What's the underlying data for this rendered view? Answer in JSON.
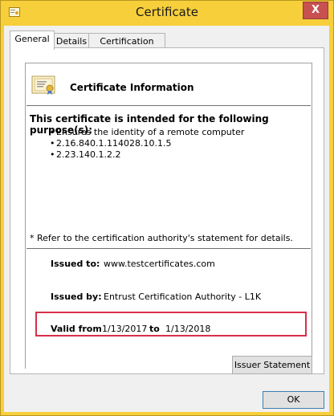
{
  "window": {
    "title": "Certificate",
    "close_label": "X"
  },
  "tabs": [
    {
      "label": "General"
    },
    {
      "label": "Details"
    },
    {
      "label": "Certification Path"
    }
  ],
  "general": {
    "heading": "Certificate Information",
    "purpose_heading": "This certificate is intended for the following purpose(s):",
    "purposes": [
      "Ensures the identity of a remote computer",
      "2.16.840.1.114028.10.1.5",
      "2.23.140.1.2.2"
    ],
    "note": "* Refer to the certification authority's statement for details.",
    "issued_to_label": "Issued to:",
    "issued_to_value": "www.testcertificates.com",
    "issued_by_label": "Issued by:",
    "issued_by_value": "Entrust Certification Authority - L1K",
    "valid_from_label": "Valid from",
    "valid_from_value": "1/13/2017",
    "valid_to_label": "to",
    "valid_to_value": "1/13/2018"
  },
  "buttons": {
    "issuer_statement": "Issuer Statement",
    "ok": "OK"
  },
  "colors": {
    "title_bar": "#f6cf3b",
    "close_button": "#c75050",
    "highlight_box": "#d9304a"
  }
}
